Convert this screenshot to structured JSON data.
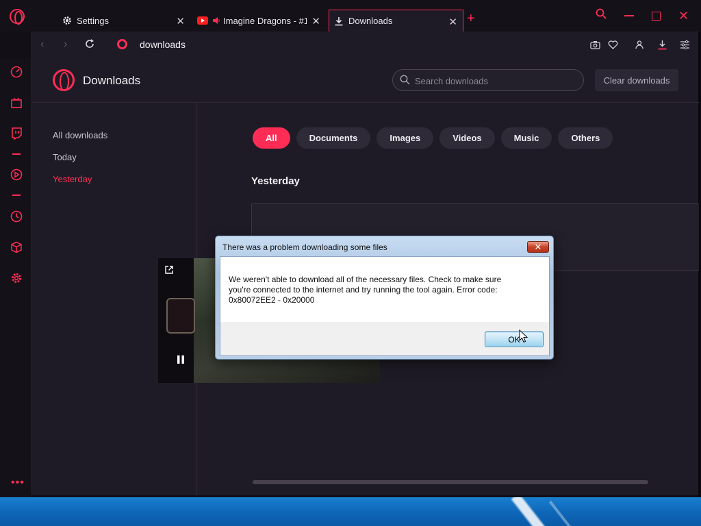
{
  "tabs": [
    {
      "label": "Settings",
      "icon": "gear-icon"
    },
    {
      "label": "Imagine Dragons - #1 (",
      "icon": "youtube-icon",
      "audio": "speaker-icon"
    },
    {
      "label": "Downloads",
      "icon": "download-icon"
    }
  ],
  "address": {
    "text": "downloads"
  },
  "page": {
    "title": "Downloads",
    "search_placeholder": "Search downloads",
    "clear_label": "Clear downloads"
  },
  "nav": [
    {
      "label": "All downloads"
    },
    {
      "label": "Today"
    },
    {
      "label": "Yesterday",
      "active": true
    }
  ],
  "filters": [
    {
      "label": "All",
      "active": true
    },
    {
      "label": "Documents"
    },
    {
      "label": "Images"
    },
    {
      "label": "Videos"
    },
    {
      "label": "Music"
    },
    {
      "label": "Others"
    }
  ],
  "section": {
    "title": "Yesterday"
  },
  "dialog": {
    "title": "There was a problem downloading some files",
    "message": "We weren't able to download all of the necessary files. Check to make sure you're connected to the internet and try running the tool again. Error code: 0x80072EE2 - 0x20000",
    "ok_label": "OK"
  },
  "colors": {
    "accent": "#ff2d55",
    "background": "#1f1b26"
  }
}
